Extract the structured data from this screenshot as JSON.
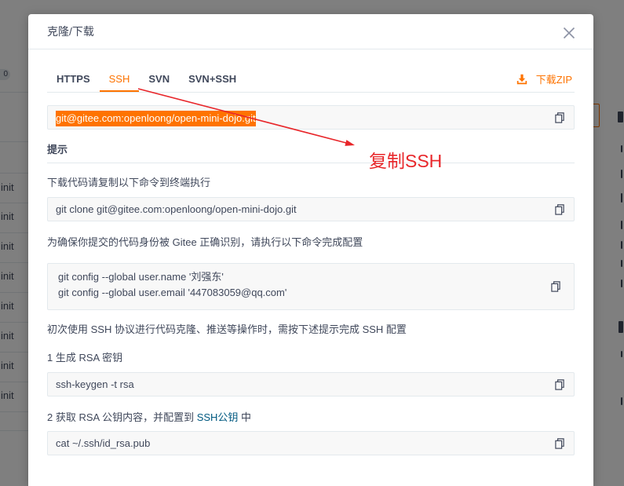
{
  "background_page": {
    "badge_count": "0",
    "commit_rows": [
      "init",
      "init",
      "init",
      "init",
      "init",
      "init",
      "init",
      "init"
    ]
  },
  "modal": {
    "title": "克隆/下载",
    "tabs": [
      {
        "label": "HTTPS",
        "active": false
      },
      {
        "label": "SSH",
        "active": true
      },
      {
        "label": "SVN",
        "active": false
      },
      {
        "label": "SVN+SSH",
        "active": false
      }
    ],
    "download_zip": {
      "label": "下载ZIP"
    },
    "clone_url": "git@gitee.com:openloong/open-mini-dojo.git",
    "clone_url_selected": true,
    "tips_heading": "提示",
    "instructions": {
      "clone_hint": "下载代码请复制以下命令到终端执行",
      "clone_command": "git clone git@gitee.com:openloong/open-mini-dojo.git",
      "config_hint": "为确保你提交的代码身份被 Gitee 正确识别，请执行以下命令完成配置",
      "config_commands": [
        "git config --global user.name '刘强东'",
        "git config --global user.email '447083059@qq.com'"
      ],
      "ssh_hint": "初次使用 SSH 协议进行代码克隆、推送等操作时，需按下述提示完成 SSH 配置",
      "step1_label": "1 生成 RSA 密钥",
      "step1_command": "ssh-keygen -t rsa",
      "step2_prefix": "2 获取 RSA 公钥内容，并配置到 ",
      "step2_link": "SSH公钥",
      "step2_suffix": " 中",
      "step2_command": "cat ~/.ssh/id_rsa.pub"
    }
  },
  "icons": {
    "close": "close-icon",
    "download": "download-icon",
    "copy": "copy-icon"
  },
  "annotation": {
    "label": "复制SSH"
  },
  "colors": {
    "accent": "#fe7300",
    "link": "#005980",
    "text": "#40485b",
    "annotation": "#e8262a",
    "selection": "#fe7300"
  }
}
